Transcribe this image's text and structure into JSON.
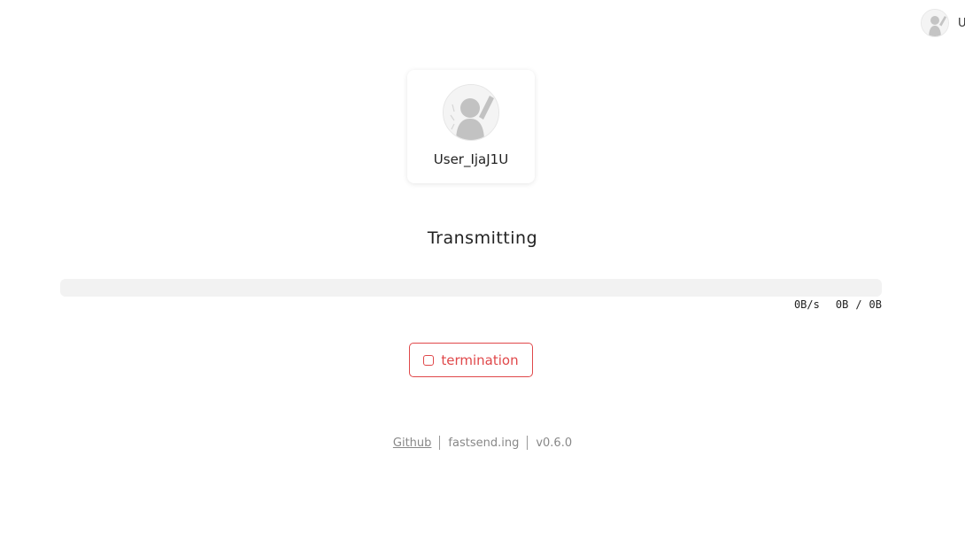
{
  "self_user": {
    "avatar_icon": "user-avatar-icon",
    "name": "User_IjaJ1U"
  },
  "peer": {
    "avatar_icon": "user-avatar-icon",
    "name": "User_IjaJ1U"
  },
  "transfer": {
    "status": "Transmitting",
    "progress_fraction": 0,
    "speed": "0B/s",
    "transferred": "0B",
    "separator": "/",
    "total": "0B"
  },
  "actions": {
    "terminate_label": "termination",
    "terminate_icon": "stop-icon",
    "accent_color": "#e0484a"
  },
  "footer": {
    "github_label": "Github",
    "site_label": "fastsend.ing",
    "version": "v0.6.0"
  }
}
